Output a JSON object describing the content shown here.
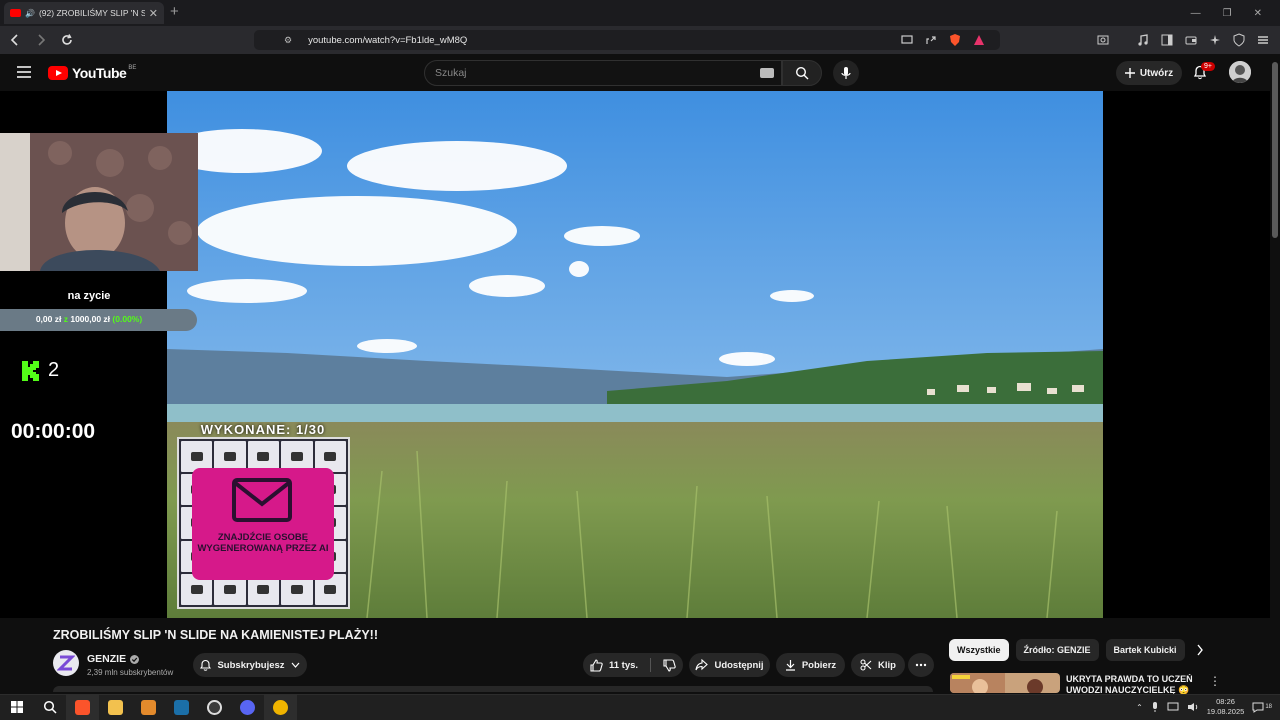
{
  "browser": {
    "tab_title": "(92) ZROBILIŚMY SLIP 'N SLIDE",
    "url": "youtube.com/watch?v=Fb1lde_wM8Q"
  },
  "youtube": {
    "logo_text": "YouTube",
    "region": "BE",
    "search_placeholder": "Szukaj",
    "create_label": "Utwórz",
    "notifications": "9+"
  },
  "overlay": {
    "goal_label": "na zycie",
    "goal_amount": "0,00 zł",
    "goal_of": "z",
    "goal_target": "1000,00 zł",
    "goal_percent": "(0.00%)",
    "kick_viewers": "2",
    "timer": "00:00:00",
    "bingo_title": "WYKONANE: 1/30",
    "bingo_task": "ZNAJDŹCIE OSOBĘ WYGENEROWANĄ PRZEZ AI"
  },
  "video": {
    "title": "ZROBILIŚMY SLIP 'N SLIDE NA KAMIENISTEJ PLAŻY!!",
    "channel": "GENZIE",
    "subscribers": "2,39 mln subskrybentów",
    "subscribe_label": "Subskrybujesz",
    "likes": "11 tys.",
    "share_label": "Udostępnij",
    "download_label": "Pobierz",
    "clip_label": "Klip"
  },
  "sidebar": {
    "chips": [
      {
        "label": "Wszystkie",
        "active": true
      },
      {
        "label": "Źródło: GENZIE",
        "active": false
      },
      {
        "label": "Bartek Kubicki",
        "active": false
      }
    ],
    "rec_title": "UKRYTA PRAWDA TO UCZEŃ UWODZI NAUCZYCIELKĘ 😳"
  },
  "taskbar": {
    "time": "08:26",
    "date": "19.08.2025",
    "notif_count": "18"
  },
  "colors": {
    "youtube_red": "#ff0000",
    "kick_green": "#53fc18",
    "bingo_pink": "#d6198a"
  }
}
